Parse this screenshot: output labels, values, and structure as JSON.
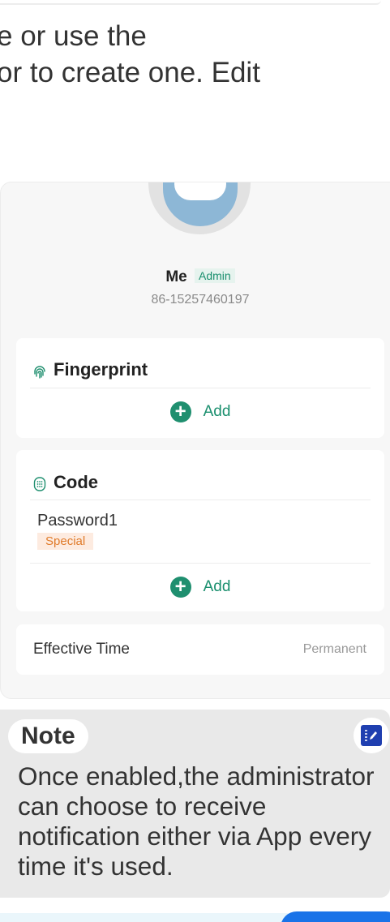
{
  "intro_lines": [
    "e or use the",
    "or to create one. Edit"
  ],
  "preview": {
    "user_name": "Me",
    "role_badge": "Admin",
    "phone": "86-15257460197",
    "fingerprint": {
      "title": "Fingerprint",
      "icon": "fingerprint-icon",
      "add_label": "Add"
    },
    "code": {
      "title": "Code",
      "icon": "keypad-icon",
      "entry_name": "Password1",
      "entry_badge": "Special",
      "add_label": "Add"
    },
    "effective_time": {
      "label": "Effective Time",
      "value": "Permanent"
    }
  },
  "note": {
    "label": "Note",
    "edit_icon": "edit-icon",
    "text": "Once enabled,the administrator can choose to receive notification either via App every time it's used."
  },
  "colors": {
    "accent_green": "#1f8f6f",
    "badge_orange": "#e07b2a",
    "edit_blue": "#1f3fb0",
    "primary_blue": "#1a73e8"
  }
}
